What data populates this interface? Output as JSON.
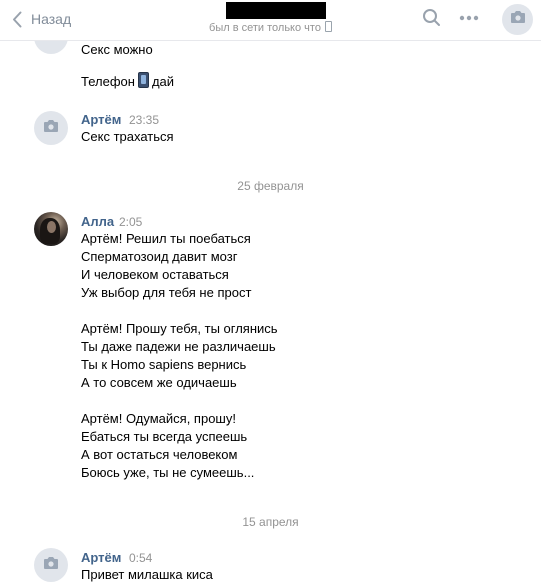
{
  "header": {
    "back_label": "Назад",
    "status_text": "был в сети только что",
    "icons": [
      "chevron-left-icon",
      "search-icon",
      "more-icon",
      "camera-icon",
      "mobile-phone-icon"
    ]
  },
  "messages": [
    {
      "author": "",
      "time": "",
      "lines": [
        "Секс можно"
      ]
    },
    {
      "author": "",
      "time": "",
      "lines": [
        "Телефон",
        "дай"
      ]
    },
    {
      "author": "Артём",
      "time": "23:35",
      "lines": [
        "Секс трахаться"
      ]
    },
    {
      "author": "Алла",
      "time": "2:05",
      "lines": [
        "Артём! Решил ты поебаться",
        "Сперматозоид давит мозг",
        "И человеком оставаться",
        "Уж выбор для тебя не прост",
        "Артём! Прошу тебя, ты оглянись",
        "Ты даже падежи не различаешь",
        "Ты к Homo sapiens вернись",
        "А то совсем же одичаешь",
        "Артём! Одумайся, прошу!",
        "Ебаться ты всегда успеешь",
        "А вот остаться человеком",
        "Боюсь уже, ты не сумеешь..."
      ]
    },
    {
      "author": "Артём",
      "time": "0:54",
      "lines": [
        "Привет милашка киса"
      ]
    }
  ],
  "date_separators": [
    "25 февраля",
    "15 апреля"
  ],
  "colors": {
    "link": "#42648b",
    "muted": "#939393",
    "avatar_bg": "#e1e5eb",
    "icon": "#99a2ad"
  }
}
